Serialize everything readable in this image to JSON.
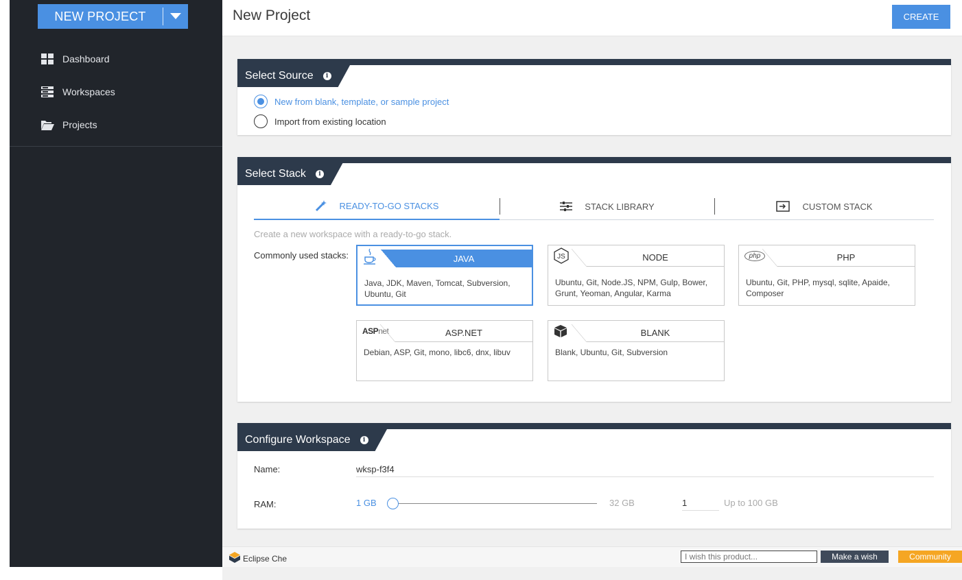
{
  "sidebar": {
    "new_project_label": "NEW PROJECT",
    "items": [
      {
        "label": "Dashboard",
        "icon": "dashboard-icon"
      },
      {
        "label": "Workspaces",
        "icon": "workspaces-icon"
      },
      {
        "label": "Projects",
        "icon": "folder-icon"
      }
    ]
  },
  "header": {
    "title": "New Project",
    "create_label": "CREATE"
  },
  "source": {
    "title": "Select Source",
    "options": [
      {
        "label": "New from blank, template, or sample project",
        "selected": true
      },
      {
        "label": "Import from existing location",
        "selected": false
      }
    ]
  },
  "stack": {
    "title": "Select Stack",
    "tabs": [
      {
        "label": "READY-TO-GO STACKS",
        "icon": "magic-wand-icon",
        "active": true
      },
      {
        "label": "STACK LIBRARY",
        "icon": "sliders-icon",
        "active": false
      },
      {
        "label": "CUSTOM STACK",
        "icon": "import-icon",
        "active": false
      }
    ],
    "hint": "Create a new workspace with a ready-to-go stack.",
    "common_label": "Commonly used stacks:",
    "cards": [
      {
        "name": "JAVA",
        "icon": "java-icon",
        "desc": "Java, JDK, Maven, Tomcat, Subversion, Ubuntu, Git",
        "selected": true
      },
      {
        "name": "NODE",
        "icon": "nodejs-icon",
        "desc": "Ubuntu, Git, Node.JS, NPM, Gulp, Bower, Grunt, Yeoman, Angular, Karma",
        "selected": false
      },
      {
        "name": "PHP",
        "icon": "php-icon",
        "icon_text": "php",
        "desc": "Ubuntu, Git, PHP, mysql, sqlite, Apaide, Composer",
        "selected": false
      },
      {
        "name": "ASP.NET",
        "icon": "aspnet-icon",
        "icon_text_bold": "ASP",
        "icon_text_light": "net",
        "desc": "Debian, ASP, Git, mono, libc6, dnx, libuv",
        "selected": false
      },
      {
        "name": "BLANK",
        "icon": "cube-icon",
        "desc": "Blank, Ubuntu, Git, Subversion",
        "selected": false
      }
    ]
  },
  "workspace": {
    "title": "Configure Workspace",
    "name_label": "Name:",
    "name_value": "wksp-f3f4",
    "ram_label": "RAM:",
    "ram_min": "1 GB",
    "ram_max": "32 GB",
    "ram_value": "1",
    "ram_hint": "Up to 100 GB",
    "ram_slider_fraction": 0
  },
  "footer": {
    "brand": "Eclipse Che",
    "wish_placeholder": "I wish this product...",
    "wish_button": "Make a wish",
    "community_button": "Community"
  },
  "colors": {
    "accent": "#4a90e2",
    "sidebar": "#21252b",
    "panel_header": "#2d3a4b",
    "community": "#f5a623"
  }
}
